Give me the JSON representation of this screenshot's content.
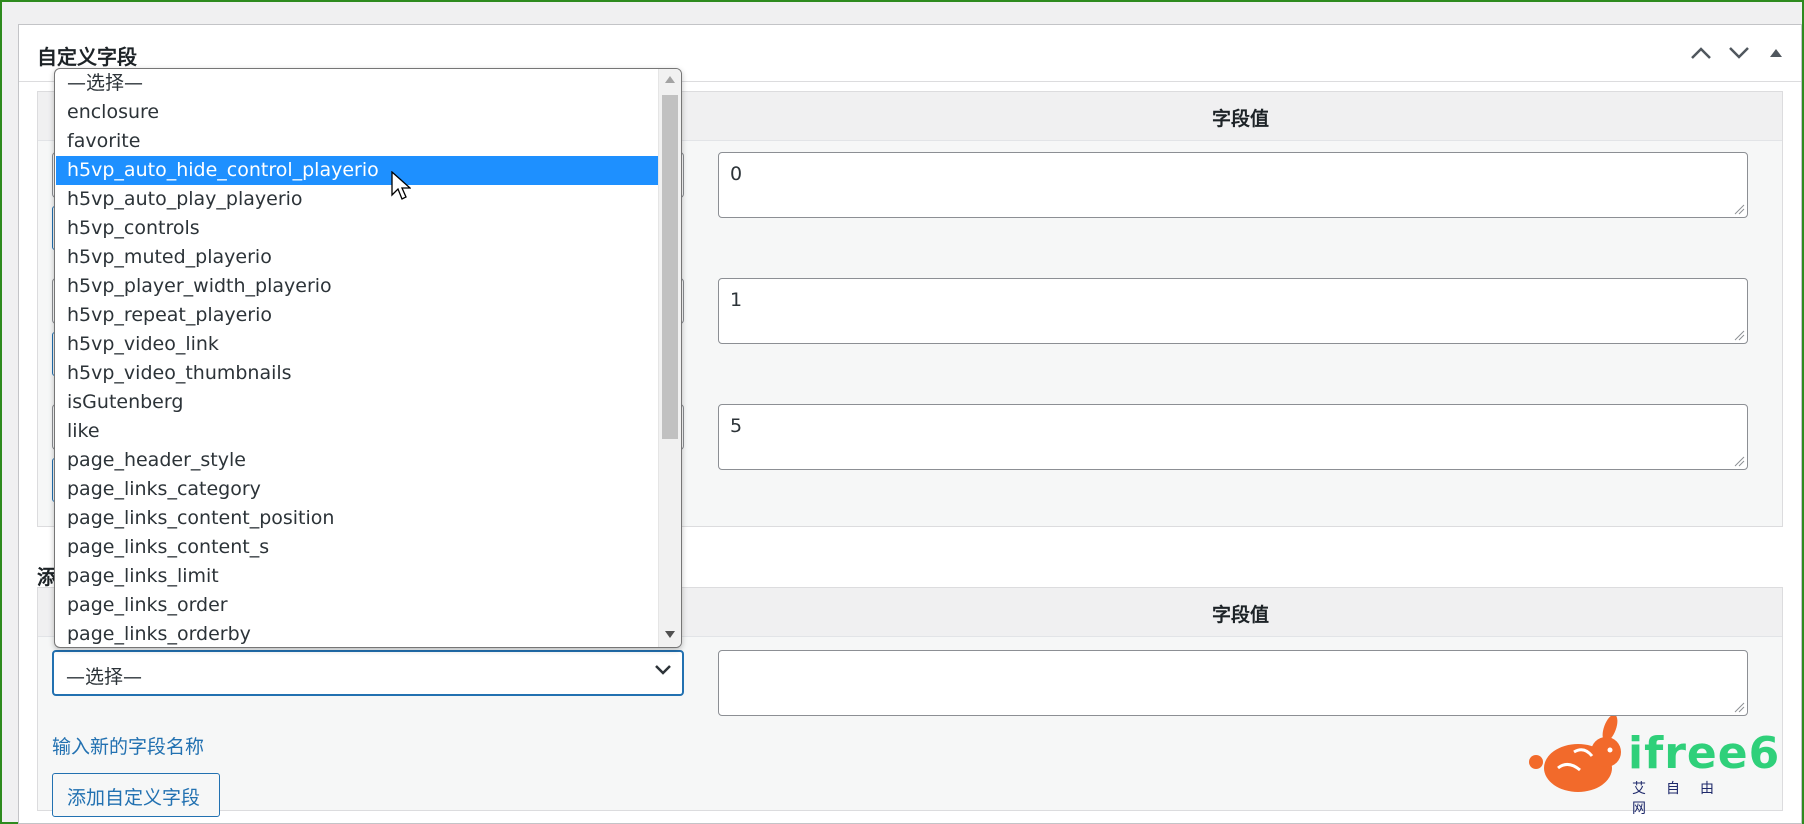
{
  "metabox": {
    "title": "自定义字段",
    "controls": [
      "chevron-up-icon",
      "chevron-down-icon",
      "triangle-up-icon"
    ]
  },
  "existing_fields": {
    "value_header": "字段值",
    "rows": [
      {
        "value": "0"
      },
      {
        "value": "1"
      },
      {
        "value": "5"
      }
    ]
  },
  "add_new": {
    "title_visible": "添",
    "value_header": "字段值",
    "select_value": "—选择—",
    "value": "",
    "enter_new_link": "输入新的字段名称",
    "add_button": "添加自定义字段"
  },
  "dropdown": {
    "selected_index": 3,
    "options": [
      "—选择—",
      "enclosure",
      "favorite",
      "h5vp_auto_hide_control_playerio",
      "h5vp_auto_play_playerio",
      "h5vp_controls",
      "h5vp_muted_playerio",
      "h5vp_player_width_playerio",
      "h5vp_repeat_playerio",
      "h5vp_video_link",
      "h5vp_video_thumbnails",
      "isGutenberg",
      "like",
      "page_header_style",
      "page_links_category",
      "page_links_content_position",
      "page_links_content_s",
      "page_links_limit",
      "page_links_order",
      "page_links_orderby"
    ]
  },
  "watermark": {
    "brand": "ifree6",
    "subtitle": "艾自由网"
  },
  "colors": {
    "accent": "#2271b1",
    "selected_option": "#1e90ff",
    "frame_border": "#2e8b1e",
    "logo_orange": "#f26a2b",
    "logo_green": "#2fd07a"
  }
}
